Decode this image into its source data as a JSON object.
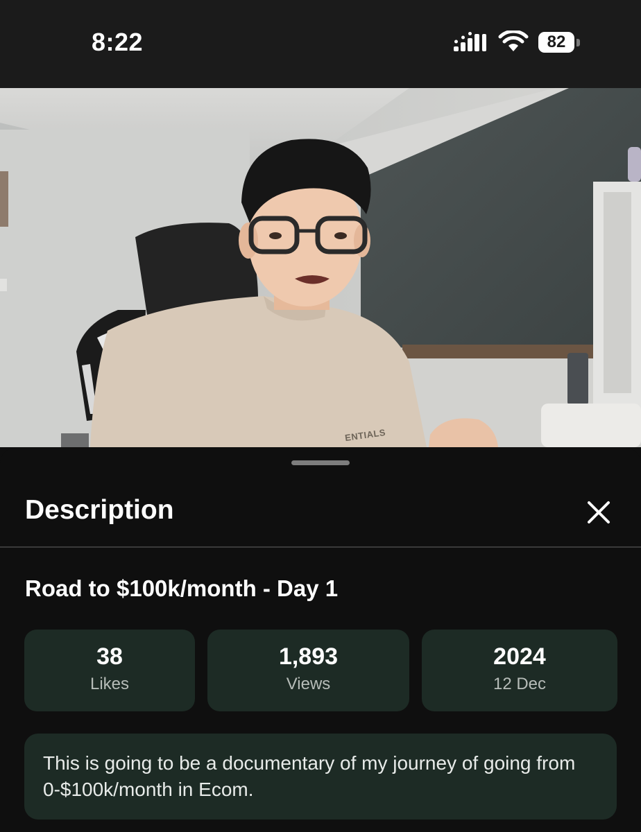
{
  "status_bar": {
    "time": "8:22",
    "battery_level": "82",
    "signal_icon": "cellular-signal-icon",
    "wifi_icon": "wifi-icon"
  },
  "video": {
    "shirt_print": "ENTIALS"
  },
  "sheet": {
    "title": "Description",
    "close_icon": "close-icon"
  },
  "video_info": {
    "title": "Road to $100k/month - Day 1",
    "stats": [
      {
        "value": "38",
        "label": "Likes"
      },
      {
        "value": "1,893",
        "label": "Views"
      },
      {
        "value": "2024",
        "label": "12 Dec"
      }
    ],
    "description": "This is going to be a documentary of my journey of going from 0-$100k/month in Ecom."
  },
  "colors": {
    "background": "#0f0f0f",
    "card": "#1d2b25",
    "secondary_text": "#b6bcb8"
  }
}
